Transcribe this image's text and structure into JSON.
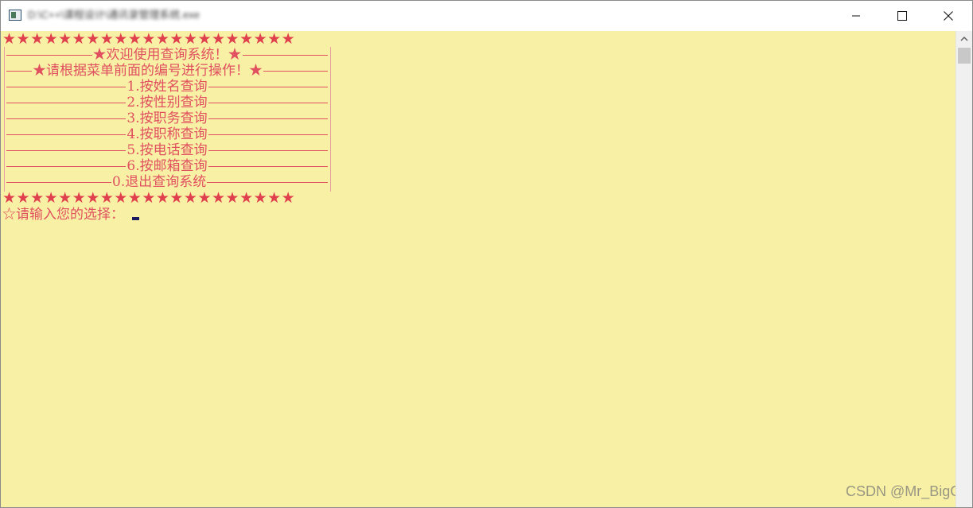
{
  "window": {
    "title": "D:\\C++\\课程设计\\通讯录管理系统.exe",
    "minimize_label": "Minimize",
    "maximize_label": "Maximize",
    "close_label": "Close"
  },
  "console": {
    "background_color": "#f8f0a4",
    "text_color": "#e05060",
    "star_row": "★★★★★★★★★★★★★★★★★★★★★",
    "menu": {
      "welcome": "★欢迎使用查询系统！★",
      "instruction": "★请根据菜单前面的编号进行操作！★",
      "items": [
        "1.按姓名查询",
        "2.按性别查询",
        "3.按职务查询",
        "4.按职称查询",
        "5.按电话查询",
        "6.按邮箱查询",
        "0.退出查询系统"
      ]
    },
    "prompt": "☆请输入您的选择：",
    "input_value": ""
  },
  "watermark": "CSDN @Mr_BigG",
  "icons": {
    "app": "console-app-icon",
    "minimize": "minimize-icon",
    "maximize": "maximize-icon",
    "close": "close-icon",
    "scroll_up": "chevron-up-icon"
  }
}
